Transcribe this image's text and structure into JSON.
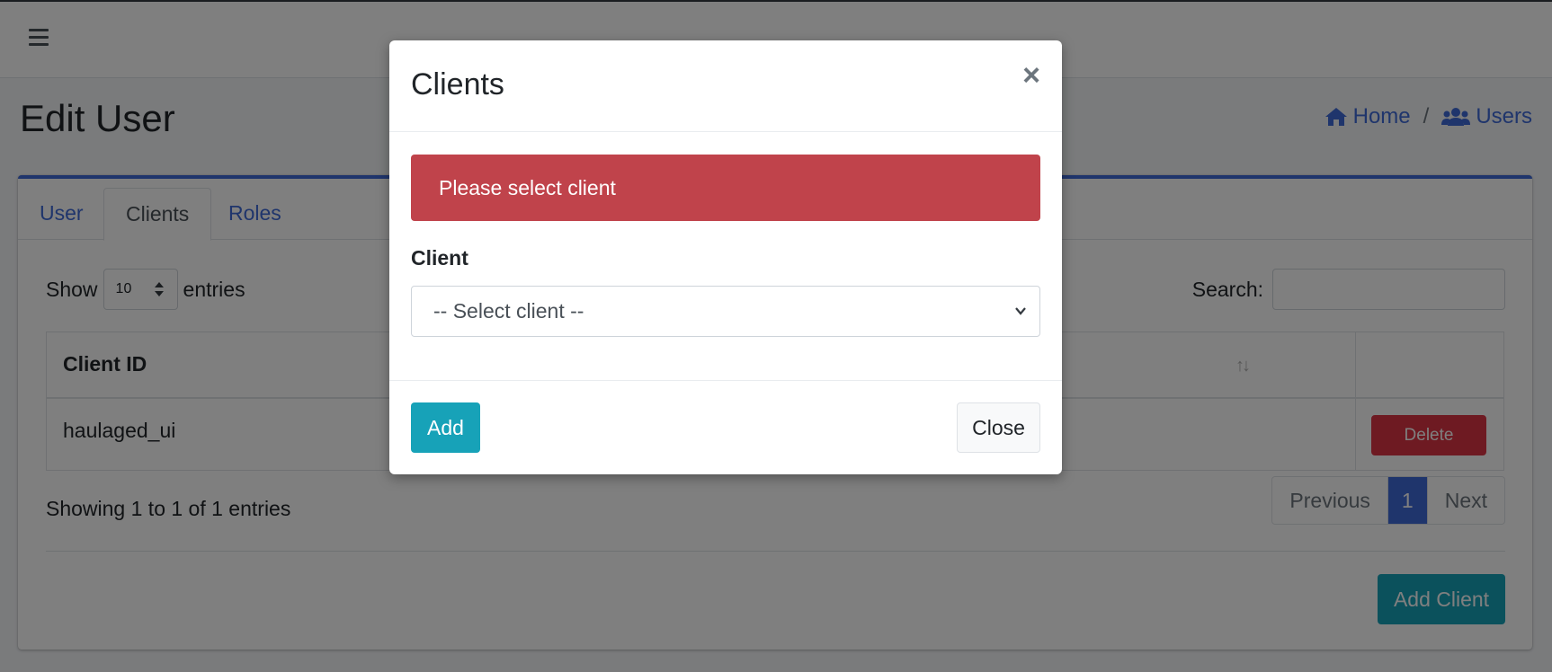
{
  "page": {
    "title": "Edit User",
    "breadcrumb": [
      {
        "label": "Home",
        "icon": "home-icon"
      },
      {
        "label": "Users",
        "icon": "users-icon"
      }
    ],
    "breadcrumb_separator": "/"
  },
  "tabs": [
    {
      "label": "User",
      "active": false
    },
    {
      "label": "Clients",
      "active": true
    },
    {
      "label": "Roles",
      "active": false
    }
  ],
  "table_controls": {
    "show_label": "Show",
    "length_value": "10",
    "entries_label": "entries",
    "search_label": "Search:",
    "search_value": ""
  },
  "table": {
    "columns": [
      "Client ID",
      ""
    ],
    "rows": [
      {
        "client_id": "haulaged_ui",
        "action": "Delete"
      }
    ]
  },
  "info_text": "Showing 1 to 1 of 1 entries",
  "pagination": {
    "previous": "Previous",
    "current": "1",
    "next": "Next"
  },
  "add_client_label": "Add Client",
  "modal": {
    "title": "Clients",
    "close_symbol": "×",
    "alert_text": "Please select client",
    "field_label": "Client",
    "select_value": "-- Select client --",
    "add_label": "Add",
    "close_label": "Close"
  },
  "colors": {
    "primary": "#3f6ad8",
    "danger": "#dc3545",
    "alert": "#c0434b",
    "info": "#17a2b8"
  }
}
